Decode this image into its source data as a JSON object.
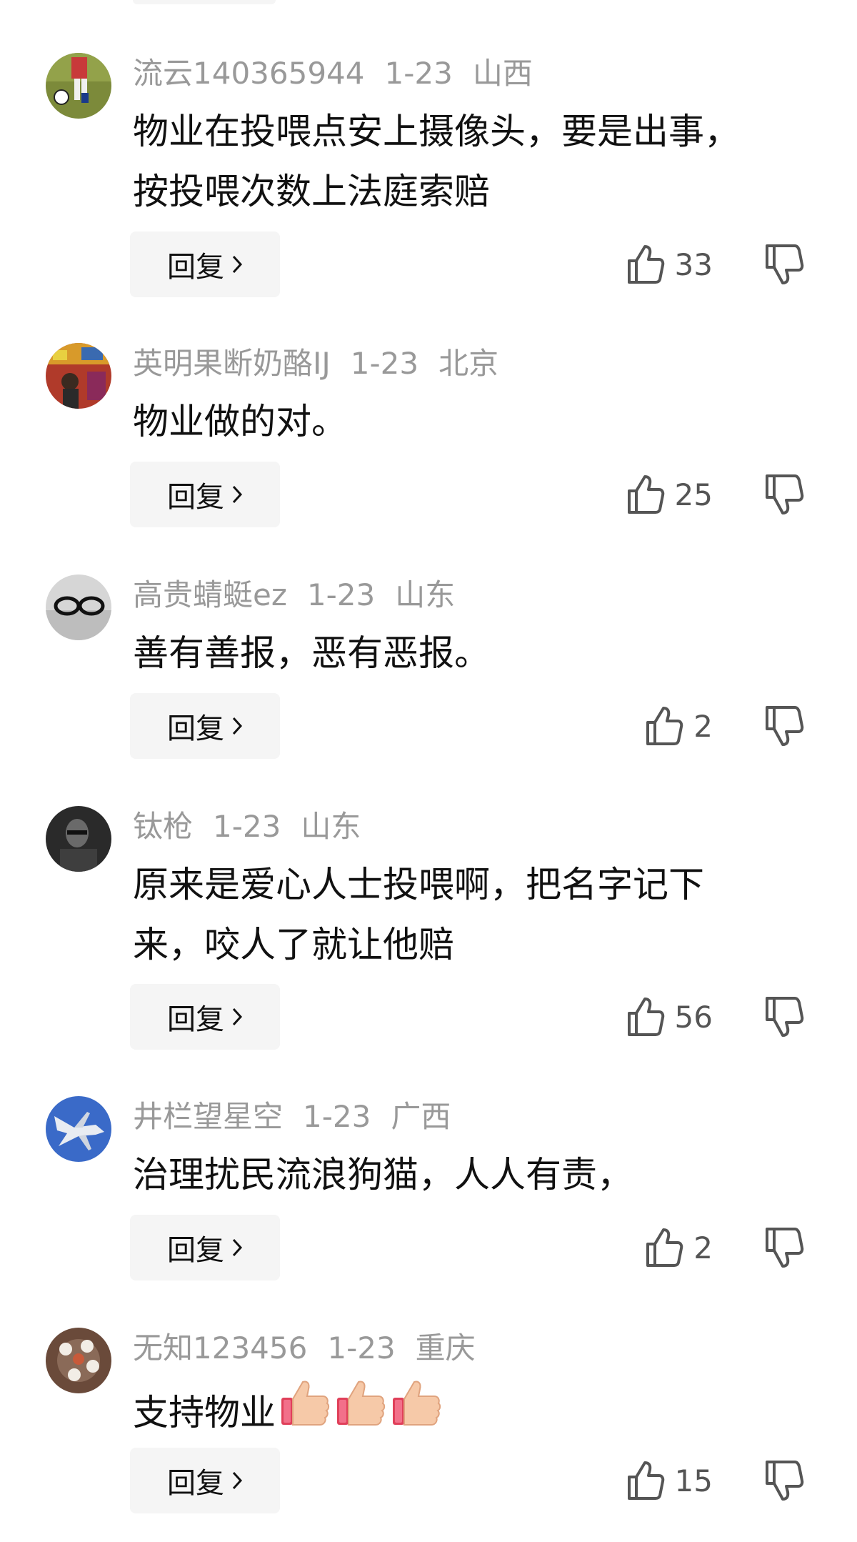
{
  "comments": [
    {
      "username": "流云140365944",
      "date": "1-23",
      "location": "山西",
      "text_lines": [
        "物业在投喂点安上摄像头，要是出事，",
        "按投喂次数上法庭索赔"
      ],
      "likes": "33",
      "avatar": "soccer-player-avatar"
    },
    {
      "username": "英明果断奶酪IJ",
      "date": "1-23",
      "location": "北京",
      "text_lines": [
        "物业做的对。"
      ],
      "likes": "25",
      "avatar": "colorful-crowd-avatar"
    },
    {
      "username": "高贵蜻蜓ez",
      "date": "1-23",
      "location": "山东",
      "text_lines": [
        "善有善报，恶有恶报。"
      ],
      "likes": "2",
      "avatar": "glasses-avatar"
    },
    {
      "username": "钛枪",
      "date": "1-23",
      "location": "山东",
      "text_lines": [
        "原来是爱心人士投喂啊，把名字记下",
        "来，咬人了就让他赔"
      ],
      "likes": "56",
      "avatar": "dark-portrait-avatar"
    },
    {
      "username": "井栏望星空",
      "date": "1-23",
      "location": "广西",
      "text_lines": [
        "治理扰民流浪狗猫，人人有责，"
      ],
      "likes": "2",
      "avatar": "fighter-jet-avatar"
    },
    {
      "username": "无知123456",
      "date": "1-23",
      "location": "重庆",
      "text_lines": [
        "支持物业"
      ],
      "emoji_count": 3,
      "emoji": "thumbs-up-emoji",
      "likes": "15",
      "avatar": "tea-set-avatar"
    }
  ],
  "reply_label": "回复",
  "colors": {
    "meta": "#999999",
    "text": "#111111",
    "reply_bg": "#f5f5f5",
    "icon": "#555555"
  }
}
